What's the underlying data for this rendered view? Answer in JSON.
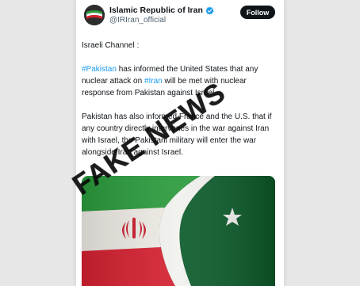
{
  "tweet": {
    "display_name": "Islamic Republic of Iran",
    "handle": "@IRIran_official",
    "follow_label": "Follow",
    "intro": "Israeli Channel :",
    "p1_hashtag1": "#Pakistan",
    "p1_part1": " has informed the United States that any nuclear attack on ",
    "p1_hashtag2": "#Iran",
    "p1_part2": " will be met with nuclear response from Pakistan against Israel.",
    "p2": "Pakistan has also informed France and the U.S. that if any country directly intervenes in the war against Iran with Israel, the Pakistani military will enter the war alongside Iran against Israel."
  },
  "overlay": {
    "stamp_text": "FAKE NEWS"
  },
  "colors": {
    "hashtag": "#1d9bf0",
    "verified": "#1d9bf0",
    "iran_green": "#2a9a3c",
    "iran_red": "#da1f2f",
    "pakistan_green": "#01411c"
  },
  "icons": {
    "verified": "verified-badge-icon",
    "avatar": "iran-flag-avatar"
  }
}
